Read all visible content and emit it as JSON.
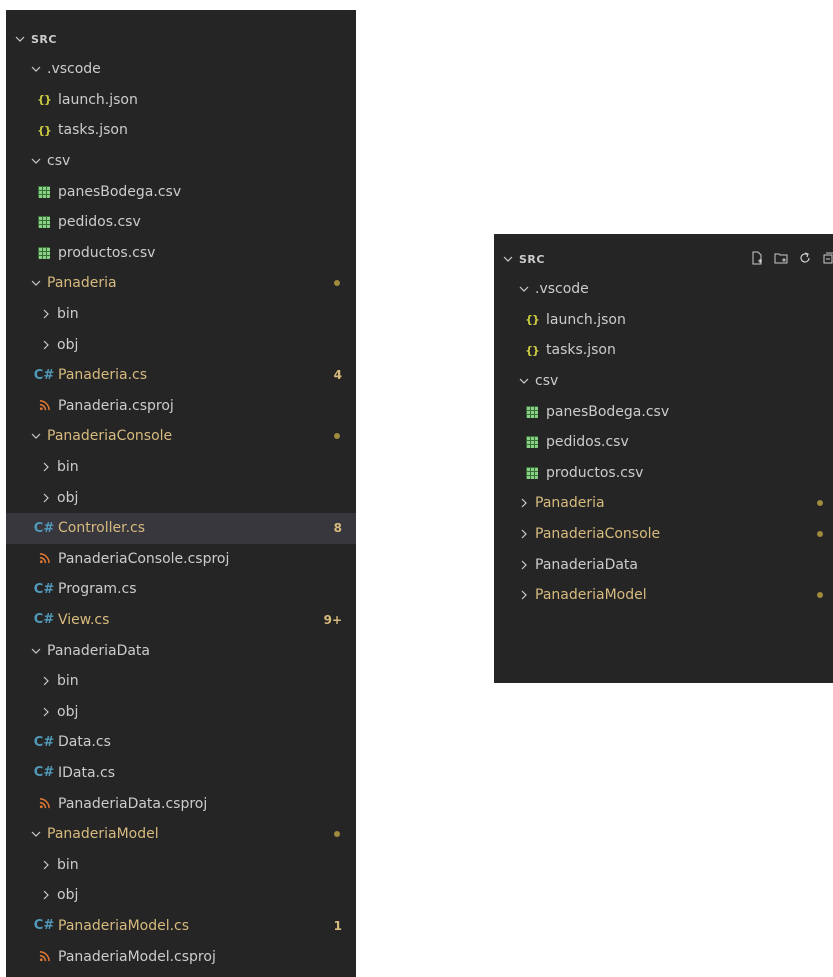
{
  "explorer_left": {
    "title": "SRC",
    "items": [
      {
        "label": ".vscode",
        "kind": "folder",
        "expanded": true,
        "depth": 1
      },
      {
        "label": "launch.json",
        "kind": "json",
        "depth": 2
      },
      {
        "label": "tasks.json",
        "kind": "json",
        "depth": 2
      },
      {
        "label": "csv",
        "kind": "folder",
        "expanded": true,
        "depth": 1
      },
      {
        "label": "panesBodega.csv",
        "kind": "csv",
        "depth": 2
      },
      {
        "label": "pedidos.csv",
        "kind": "csv",
        "depth": 2
      },
      {
        "label": "productos.csv",
        "kind": "csv",
        "depth": 2
      },
      {
        "label": "Panaderia",
        "kind": "folder",
        "expanded": true,
        "depth": 1,
        "modified": true,
        "dot": true
      },
      {
        "label": "bin",
        "kind": "folder",
        "expanded": false,
        "depth": 2
      },
      {
        "label": "obj",
        "kind": "folder",
        "expanded": false,
        "depth": 2
      },
      {
        "label": "Panaderia.cs",
        "kind": "cs",
        "depth": 2,
        "modified": true,
        "badge": "4"
      },
      {
        "label": "Panaderia.csproj",
        "kind": "csproj",
        "depth": 2
      },
      {
        "label": "PanaderiaConsole",
        "kind": "folder",
        "expanded": true,
        "depth": 1,
        "modified": true,
        "dot": true
      },
      {
        "label": "bin",
        "kind": "folder",
        "expanded": false,
        "depth": 2
      },
      {
        "label": "obj",
        "kind": "folder",
        "expanded": false,
        "depth": 2
      },
      {
        "label": "Controller.cs",
        "kind": "cs",
        "depth": 2,
        "modified": true,
        "badge": "8",
        "selected": true
      },
      {
        "label": "PanaderiaConsole.csproj",
        "kind": "csproj",
        "depth": 2
      },
      {
        "label": "Program.cs",
        "kind": "cs",
        "depth": 2
      },
      {
        "label": "View.cs",
        "kind": "cs",
        "depth": 2,
        "modified": true,
        "badge": "9+"
      },
      {
        "label": "PanaderiaData",
        "kind": "folder",
        "expanded": true,
        "depth": 1
      },
      {
        "label": "bin",
        "kind": "folder",
        "expanded": false,
        "depth": 2
      },
      {
        "label": "obj",
        "kind": "folder",
        "expanded": false,
        "depth": 2
      },
      {
        "label": "Data.cs",
        "kind": "cs",
        "depth": 2
      },
      {
        "label": "IData.cs",
        "kind": "cs",
        "depth": 2
      },
      {
        "label": "PanaderiaData.csproj",
        "kind": "csproj",
        "depth": 2
      },
      {
        "label": "PanaderiaModel",
        "kind": "folder",
        "expanded": true,
        "depth": 1,
        "modified": true,
        "dot": true
      },
      {
        "label": "bin",
        "kind": "folder",
        "expanded": false,
        "depth": 2
      },
      {
        "label": "obj",
        "kind": "folder",
        "expanded": false,
        "depth": 2
      },
      {
        "label": "PanaderiaModel.cs",
        "kind": "cs",
        "depth": 2,
        "modified": true,
        "badge": "1"
      },
      {
        "label": "PanaderiaModel.csproj",
        "kind": "csproj",
        "depth": 2
      }
    ]
  },
  "explorer_right": {
    "title": "SRC",
    "actions": [
      {
        "name": "new-file-icon"
      },
      {
        "name": "new-folder-icon"
      },
      {
        "name": "refresh-icon"
      },
      {
        "name": "collapse-all-icon"
      }
    ],
    "items": [
      {
        "label": ".vscode",
        "kind": "folder",
        "expanded": true,
        "depth": 1
      },
      {
        "label": "launch.json",
        "kind": "json",
        "depth": 2
      },
      {
        "label": "tasks.json",
        "kind": "json",
        "depth": 2
      },
      {
        "label": "csv",
        "kind": "folder",
        "expanded": true,
        "depth": 1
      },
      {
        "label": "panesBodega.csv",
        "kind": "csv",
        "depth": 2
      },
      {
        "label": "pedidos.csv",
        "kind": "csv",
        "depth": 2
      },
      {
        "label": "productos.csv",
        "kind": "csv",
        "depth": 2
      },
      {
        "label": "Panaderia",
        "kind": "folder",
        "expanded": false,
        "depth": 1,
        "modified": true,
        "dot": true
      },
      {
        "label": "PanaderiaConsole",
        "kind": "folder",
        "expanded": false,
        "depth": 1,
        "modified": true,
        "dot": true
      },
      {
        "label": "PanaderiaData",
        "kind": "folder",
        "expanded": false,
        "depth": 1
      },
      {
        "label": "PanaderiaModel",
        "kind": "folder",
        "expanded": false,
        "depth": 1,
        "modified": true,
        "dot": true
      }
    ]
  },
  "icons": {
    "json": "{}",
    "cs": "C#",
    "csproj": "rss-icon",
    "csv": "table-icon"
  },
  "colors": {
    "panel_bg": "#252526",
    "text": "#cccccc",
    "modified": "#d7ba7d",
    "selection": "#37373d",
    "cs_icon": "#519aba",
    "csv_icon": "#89d185",
    "json_icon": "#cbcb41",
    "csproj_icon": "#e37933"
  }
}
